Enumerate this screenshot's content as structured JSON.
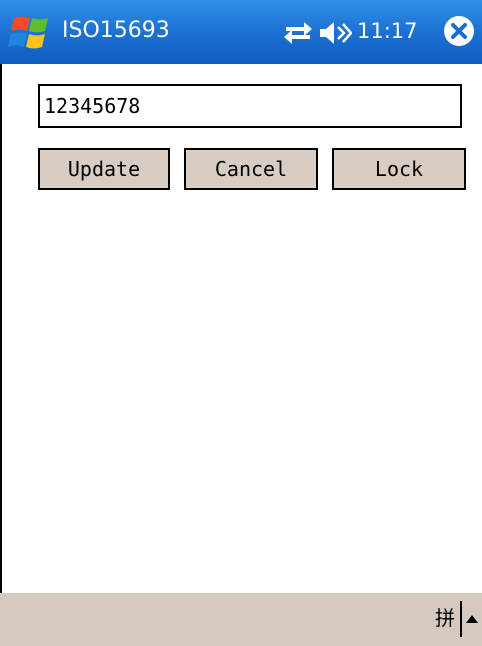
{
  "titlebar": {
    "app_title": "ISO15693",
    "clock": "11:17",
    "icons": {
      "start": "windows-start-icon",
      "connectivity": "connectivity-icon",
      "volume": "volume-icon",
      "close": "close-icon"
    },
    "accent_color": "#1a6fd0"
  },
  "form": {
    "tag_value": "12345678",
    "buttons": {
      "update": "Update",
      "cancel": "Cancel",
      "lock": "Lock"
    },
    "button_color": "#d9cdc3"
  },
  "menubar": {
    "ime_label": "拼",
    "sip_icon": "sip-up-arrow-icon",
    "background": "#d6c9bf"
  }
}
